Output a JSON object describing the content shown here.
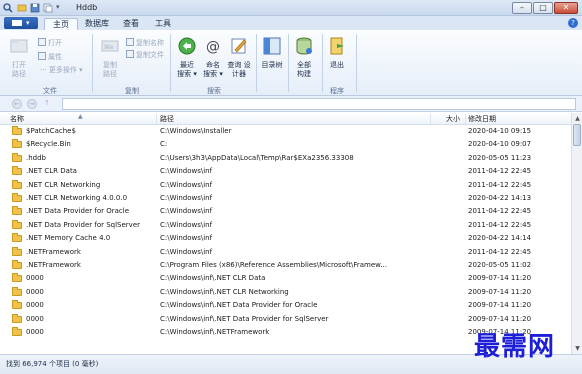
{
  "window": {
    "title": "Hddb"
  },
  "tabs": [
    {
      "label": "主页",
      "active": true
    },
    {
      "label": "数据库",
      "active": false
    },
    {
      "label": "查看",
      "active": false
    },
    {
      "label": "工具",
      "active": false
    }
  ],
  "ribbon": {
    "file_group": {
      "label": "文件",
      "open_path": [
        "打开",
        "路径"
      ],
      "open": "打开",
      "properties": "属性",
      "more_ops": "··· 更多操作 ▾"
    },
    "copy_group": {
      "label": "复制",
      "copy_path": [
        "复制",
        "路径"
      ],
      "copy_name": "复制名称",
      "copy_file": "复制文件"
    },
    "search_group": {
      "label": "搜索",
      "recent_search": [
        "最近",
        "搜索 ▾"
      ],
      "name_search": [
        "命名",
        "搜索 ▾"
      ],
      "query_designer": [
        "查询 设",
        "计器"
      ]
    },
    "dir_tree": "目录树",
    "rebuild": [
      "全部",
      "构建"
    ],
    "program_group": {
      "label": "程序",
      "exit": "退出"
    }
  },
  "list": {
    "columns": {
      "name": "名称",
      "path": "路径",
      "size": "大小",
      "modified": "修改日期"
    },
    "rows": [
      {
        "name": "$PatchCache$",
        "path": "C:\\Windows\\Installer",
        "size": "",
        "modified": "2020-04-10 09:15"
      },
      {
        "name": "$Recycle.Bin",
        "path": "C:",
        "size": "",
        "modified": "2020-04-10 09:07"
      },
      {
        "name": ".hddb",
        "path": "C:\\Users\\3h3\\AppData\\Local\\Temp\\Rar$EXa2356.33308",
        "size": "",
        "modified": "2020-05-05 11:23"
      },
      {
        "name": ".NET CLR Data",
        "path": "C:\\Windows\\inf",
        "size": "",
        "modified": "2011-04-12 22:45"
      },
      {
        "name": ".NET CLR Networking",
        "path": "C:\\Windows\\inf",
        "size": "",
        "modified": "2011-04-12 22:45"
      },
      {
        "name": ".NET CLR Networking 4.0.0.0",
        "path": "C:\\Windows\\inf",
        "size": "",
        "modified": "2020-04-22 14:13"
      },
      {
        "name": ".NET Data Provider for Oracle",
        "path": "C:\\Windows\\inf",
        "size": "",
        "modified": "2011-04-12 22:45"
      },
      {
        "name": ".NET Data Provider for SqlServer",
        "path": "C:\\Windows\\inf",
        "size": "",
        "modified": "2011-04-12 22:45"
      },
      {
        "name": ".NET Memory Cache 4.0",
        "path": "C:\\Windows\\inf",
        "size": "",
        "modified": "2020-04-22 14:14"
      },
      {
        "name": ".NETFramework",
        "path": "C:\\Windows\\inf",
        "size": "",
        "modified": "2011-04-12 22:45"
      },
      {
        "name": ".NETFramework",
        "path": "C:\\Program Files (x86)\\Reference Assemblies\\Microsoft\\Framew...",
        "size": "",
        "modified": "2020-05-05 11:02"
      },
      {
        "name": "0000",
        "path": "C:\\Windows\\inf\\.NET CLR Data",
        "size": "",
        "modified": "2009-07-14 11:20"
      },
      {
        "name": "0000",
        "path": "C:\\Windows\\inf\\.NET CLR Networking",
        "size": "",
        "modified": "2009-07-14 11:20"
      },
      {
        "name": "0000",
        "path": "C:\\Windows\\inf\\.NET Data Provider for Oracle",
        "size": "",
        "modified": "2009-07-14 11:20"
      },
      {
        "name": "0000",
        "path": "C:\\Windows\\inf\\.NET Data Provider for SqlServer",
        "size": "",
        "modified": "2009-07-14 11:20"
      },
      {
        "name": "0000",
        "path": "C:\\Windows\\inf\\.NETFramework",
        "size": "",
        "modified": "2009-07-14 11:20"
      }
    ]
  },
  "status": {
    "text": "找到 66,974 个项目 (0 毫秒)"
  },
  "watermark": "最需网"
}
